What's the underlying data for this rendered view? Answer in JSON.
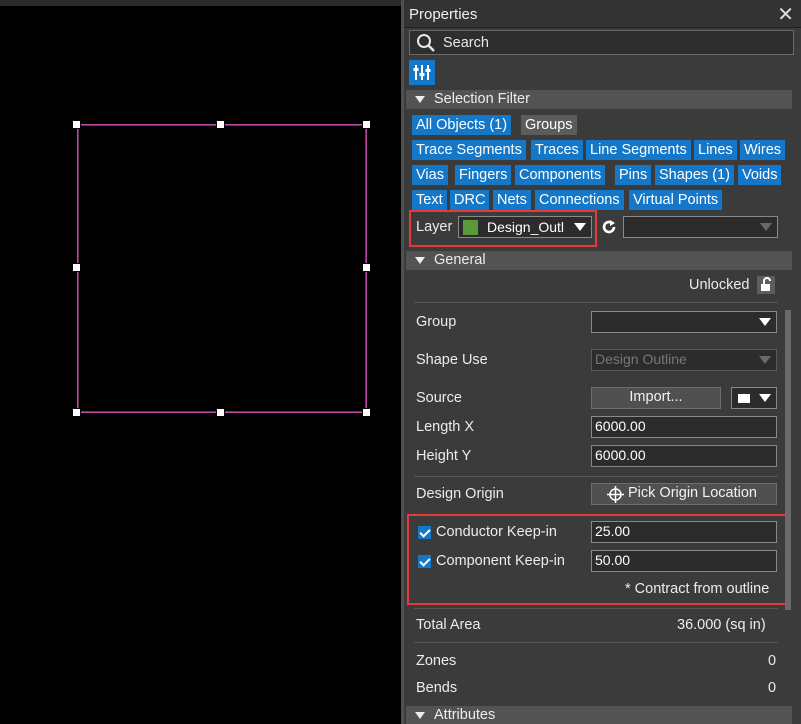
{
  "panel": {
    "title": "Properties",
    "close": "✕",
    "search_placeholder": "Search",
    "filter_icon": "sliders-icon"
  },
  "selection_filter": {
    "title": "Selection Filter",
    "chips": [
      {
        "label": "All Objects (1)",
        "active": true
      },
      {
        "label": "Groups",
        "active": false
      },
      {
        "label": "Trace Segments",
        "active": true
      },
      {
        "label": "Traces",
        "active": true
      },
      {
        "label": "Line Segments",
        "active": true
      },
      {
        "label": "Lines",
        "active": true
      },
      {
        "label": "Wires",
        "active": true
      },
      {
        "label": "Vias",
        "active": true
      },
      {
        "label": "Fingers",
        "active": true
      },
      {
        "label": "Components",
        "active": true
      },
      {
        "label": "Pins",
        "active": true
      },
      {
        "label": "Shapes (1)",
        "active": true
      },
      {
        "label": "Voids",
        "active": true
      },
      {
        "label": "Text",
        "active": true
      },
      {
        "label": "DRC",
        "active": true
      },
      {
        "label": "Nets",
        "active": true
      },
      {
        "label": "Connections",
        "active": true
      },
      {
        "label": "Virtual Points",
        "active": true
      }
    ],
    "layer_label": "Layer",
    "layer_value": "Design_Outl",
    "layer_color": "#5a9a3a",
    "secondary_value": ""
  },
  "general": {
    "title": "General",
    "lock_status": "Unlocked",
    "group_label": "Group",
    "group_value": "",
    "shape_use_label": "Shape Use",
    "shape_use_value": "Design Outline",
    "source_label": "Source",
    "import_label": "Import...",
    "length_x_label": "Length X",
    "length_x_value": "6000.00",
    "height_y_label": "Height Y",
    "height_y_value": "6000.00",
    "design_origin_label": "Design Origin",
    "pick_origin_label": "Pick Origin Location",
    "conductor_label": "Conductor Keep-in",
    "conductor_value": "25.00",
    "conductor_checked": true,
    "component_label": "Component Keep-in",
    "component_value": "50.00",
    "component_checked": true,
    "contract_note": "* Contract from outline",
    "total_area_label": "Total Area",
    "total_area_value": "36.000 (sq in)",
    "zones_label": "Zones",
    "zones_value": "0",
    "bends_label": "Bends",
    "bends_value": "0"
  },
  "attributes": {
    "title": "Attributes"
  },
  "colors": {
    "accent": "#1577c8",
    "highlight": "#e53a3a",
    "outline": "#c24aa8"
  }
}
